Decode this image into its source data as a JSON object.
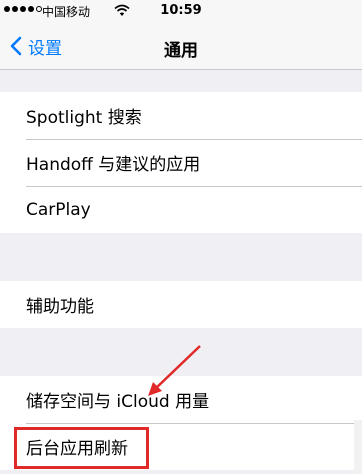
{
  "status_bar": {
    "carrier": "中国移动",
    "time": "10:59"
  },
  "nav": {
    "back_label": "设置",
    "title": "通用"
  },
  "groups": [
    [
      "Spotlight 搜索",
      "Handoff 与建议的应用",
      "CarPlay"
    ],
    [
      "辅助功能"
    ],
    [
      "储存空间与 iCloud 用量",
      "后台应用刷新"
    ]
  ],
  "colors": {
    "accent": "#007aff",
    "highlight": "#e02a2a"
  }
}
